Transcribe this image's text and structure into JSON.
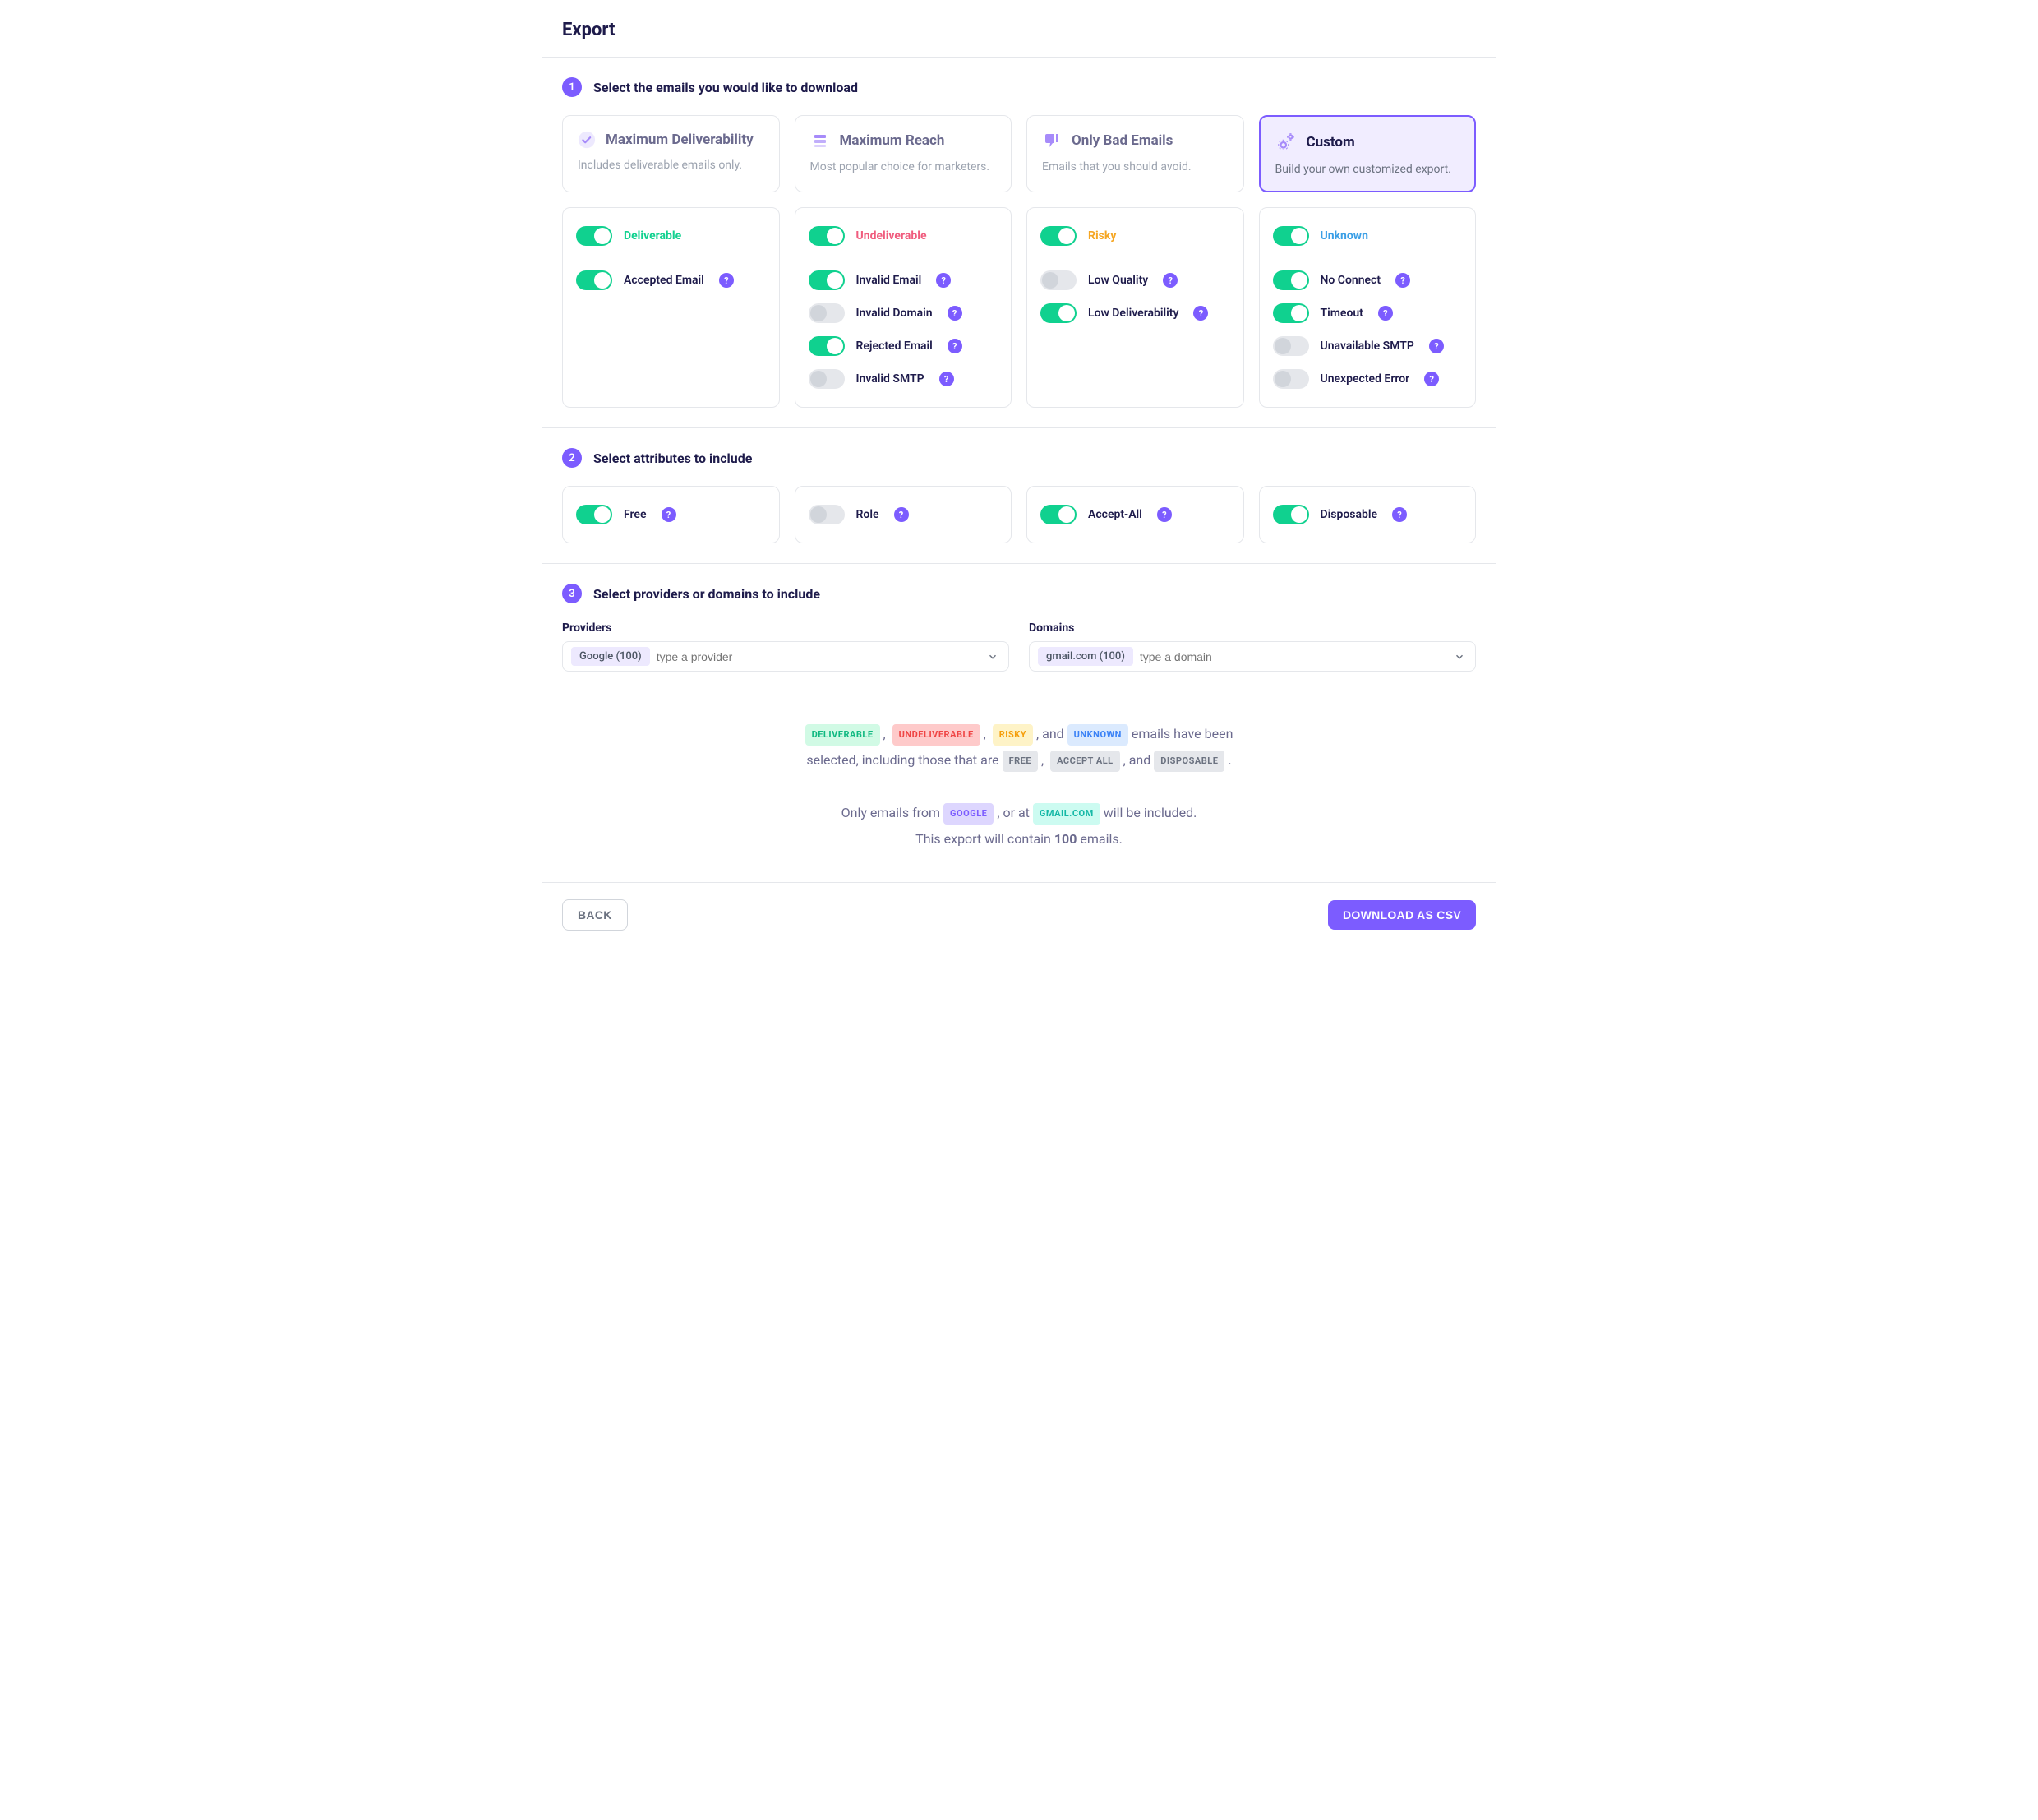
{
  "header": {
    "title": "Export"
  },
  "step1": {
    "number": "1",
    "title": "Select the emails you would like to download",
    "cards": [
      {
        "title": "Maximum Deliverability",
        "subtitle": "Includes deliverable emails only.",
        "icon": "check-circle",
        "selected": false
      },
      {
        "title": "Maximum Reach",
        "subtitle": "Most popular choice for marketers.",
        "icon": "layers",
        "selected": false
      },
      {
        "title": "Only Bad Emails",
        "subtitle": "Emails that you should avoid.",
        "icon": "thumbs-down",
        "selected": false
      },
      {
        "title": "Custom",
        "subtitle": "Build your own customized export.",
        "icon": "gears",
        "selected": true
      }
    ],
    "groups": [
      {
        "header": {
          "label": "Deliverable",
          "class": "deliverable",
          "checked": true
        },
        "items": [
          {
            "label": "Accepted Email",
            "checked": true
          }
        ]
      },
      {
        "header": {
          "label": "Undeliverable",
          "class": "undeliverable",
          "checked": true
        },
        "items": [
          {
            "label": "Invalid Email",
            "checked": true
          },
          {
            "label": "Invalid Domain",
            "checked": false
          },
          {
            "label": "Rejected Email",
            "checked": true
          },
          {
            "label": "Invalid SMTP",
            "checked": false
          }
        ]
      },
      {
        "header": {
          "label": "Risky",
          "class": "risky",
          "checked": true
        },
        "items": [
          {
            "label": "Low Quality",
            "checked": false
          },
          {
            "label": "Low Deliverability",
            "checked": true
          }
        ]
      },
      {
        "header": {
          "label": "Unknown",
          "class": "unknown",
          "checked": true
        },
        "items": [
          {
            "label": "No Connect",
            "checked": true
          },
          {
            "label": "Timeout",
            "checked": true
          },
          {
            "label": "Unavailable SMTP",
            "checked": false
          },
          {
            "label": "Unexpected Error",
            "checked": false
          }
        ]
      }
    ]
  },
  "step2": {
    "number": "2",
    "title": "Select attributes to include",
    "items": [
      {
        "label": "Free",
        "checked": true
      },
      {
        "label": "Role",
        "checked": false
      },
      {
        "label": "Accept-All",
        "checked": true
      },
      {
        "label": "Disposable",
        "checked": true
      }
    ]
  },
  "step3": {
    "number": "3",
    "title": "Select providers or domains to include",
    "providers": {
      "label": "Providers",
      "chip": "Google (100)",
      "placeholder": "type a provider"
    },
    "domains": {
      "label": "Domains",
      "chip": "gmail.com (100)",
      "placeholder": "type a domain"
    }
  },
  "summary": {
    "tags_status": [
      {
        "text": "DELIVERABLE",
        "cls": "green"
      },
      {
        "text": "UNDELIVERABLE",
        "cls": "red"
      },
      {
        "text": "RISKY",
        "cls": "yellow"
      },
      {
        "text": "UNKNOWN",
        "cls": "blue"
      }
    ],
    "line1_mid": ", and",
    "line1_end": "emails have been",
    "line2_start": "selected, including those that are",
    "tags_attr": [
      {
        "text": "FREE",
        "cls": "grey"
      },
      {
        "text": "ACCEPT ALL",
        "cls": "grey"
      },
      {
        "text": "DISPOSABLE",
        "cls": "grey"
      }
    ],
    "line2_mid": ", and",
    "line3_a": "Only emails from",
    "tag_provider": {
      "text": "GOOGLE",
      "cls": "purple"
    },
    "line3_b": ", or at",
    "tag_domain": {
      "text": "GMAIL.COM",
      "cls": "teal"
    },
    "line3_c": "will be included.",
    "line4_a": "This export will contain",
    "count": "100",
    "line4_b": "emails."
  },
  "footer": {
    "back": "BACK",
    "download": "DOWNLOAD AS CSV"
  }
}
